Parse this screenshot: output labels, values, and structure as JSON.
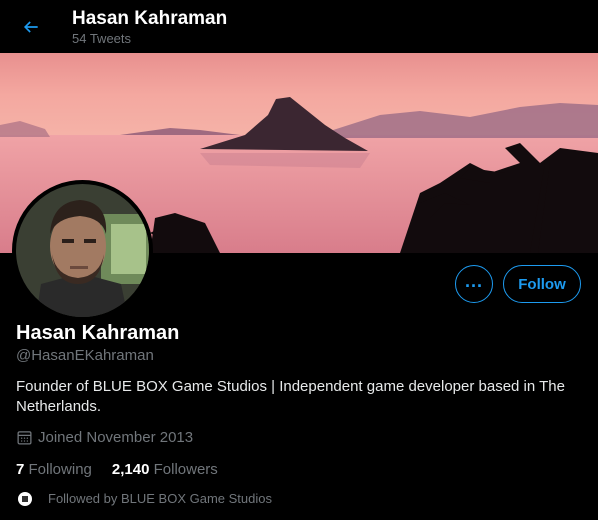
{
  "header": {
    "name": "Hasan Kahraman",
    "tweet_count": "54 Tweets"
  },
  "profile": {
    "display_name": "Hasan Kahraman",
    "handle": "@HasanEKahraman",
    "bio": "Founder of BLUE BOX Game Studios | Independent game developer based in The Netherlands.",
    "joined": "Joined November 2013",
    "following_count": "7",
    "following_label": "Following",
    "followers_count": "2,140",
    "followers_label": "Followers",
    "followed_by": "Followed by BLUE BOX Game Studios"
  },
  "actions": {
    "more_label": "...",
    "follow_label": "Follow"
  },
  "colors": {
    "accent": "#1d9bf0",
    "background": "#000000",
    "secondary_text": "#71767b"
  },
  "icons": [
    "back-arrow-icon",
    "calendar-icon",
    "more-icon"
  ]
}
